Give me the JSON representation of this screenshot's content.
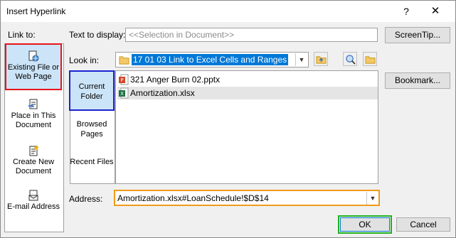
{
  "window": {
    "title": "Insert Hyperlink",
    "help_label": "?",
    "close_label": "✕"
  },
  "link_to": {
    "label": "Link to:",
    "items": [
      {
        "label": "Existing File or Web Page",
        "icon": "file-globe-icon"
      },
      {
        "label": "Place in This Document",
        "icon": "document-place-icon"
      },
      {
        "label": "Create New Document",
        "icon": "new-document-icon"
      },
      {
        "label": "E-mail Address",
        "icon": "email-icon"
      }
    ]
  },
  "text_to_display": {
    "label": "Text to display:",
    "value": "<<Selection in Document>>"
  },
  "screentip_button": "ScreenTip...",
  "look_in": {
    "label": "Look in:",
    "value": "17 01 03 Link to Excel Cells and Ranges"
  },
  "browse_options": [
    {
      "label": "Current Folder"
    },
    {
      "label": "Browsed Pages"
    },
    {
      "label": "Recent Files"
    }
  ],
  "files": [
    {
      "name": "321 Anger Burn 02.pptx",
      "icon": "powerpoint-icon"
    },
    {
      "name": "Amortization.xlsx",
      "icon": "excel-icon"
    }
  ],
  "bookmark_button": "Bookmark...",
  "address": {
    "label": "Address:",
    "value": "Amortization.xlsx#LoanSchedule!$D$14"
  },
  "ok_button": "OK",
  "cancel_button": "Cancel",
  "colors": {
    "highlight_red": "#e8141b",
    "highlight_blue": "#1b22d6",
    "highlight_orange": "#f29a1a",
    "highlight_green": "#22b122",
    "selection_blue": "#0078d7"
  }
}
